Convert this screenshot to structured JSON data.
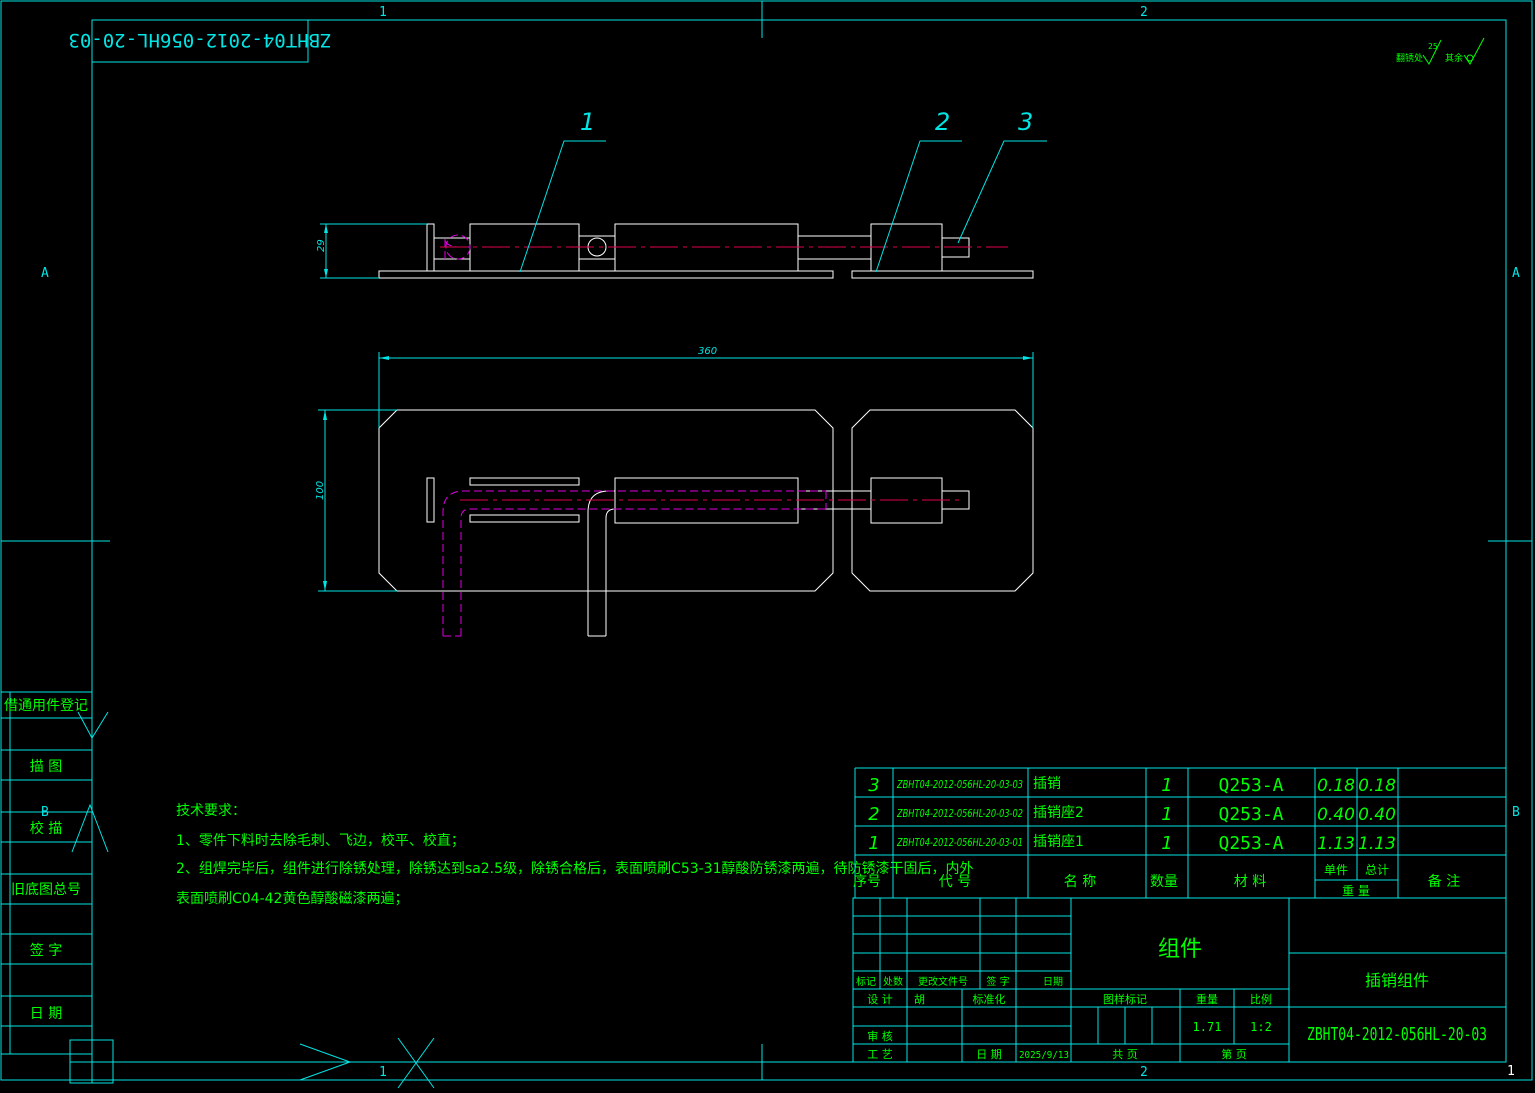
{
  "colors": {
    "frame": "#00e5e5",
    "title_text": "#00ff00",
    "geometry": "#ffffff",
    "leader": "#00e5e5",
    "centerline": "#e0004a",
    "hidden": "#e000e0",
    "dimension": "#00e5e5",
    "table_line": "#00e5e5"
  },
  "zones": {
    "col1": "1",
    "col2": "2",
    "rowA": "A",
    "rowB": "B",
    "corner": "1"
  },
  "mirrored_code": "ZBHT04-2012-056HL-20-03",
  "roughness": {
    "label1": "翻锈处",
    "value": "25",
    "label2": "其余"
  },
  "balloons": [
    "1",
    "2",
    "3"
  ],
  "dimensions": {
    "height_small": "29",
    "length": "360",
    "height_large": "100"
  },
  "left_strip": {
    "items": [
      "借通用件登记",
      "描 图",
      "校 描",
      "旧底图总号",
      "签 字",
      "日 期"
    ]
  },
  "notes": {
    "title": "技术要求：",
    "line1": "1、零件下料时去除毛刺、飞边，校平、校直；",
    "line2": "2、组焊完毕后，组件进行除锈处理，除锈达到sa2.5级，除锈合格后，表面喷刷C53-31醇酸防锈漆两遍，待防锈漆干固后，内外",
    "line3": "表面喷刷C04-42黄色醇酸磁漆两遍；"
  },
  "bom": {
    "rows": [
      {
        "no": "3",
        "code": "ZBHT04-2012-056HL-20-03-03",
        "name": "插销",
        "qty": "1",
        "material": "Q253-A",
        "unit_weight": "0.18",
        "total_weight": "0.18"
      },
      {
        "no": "2",
        "code": "ZBHT04-2012-056HL-20-03-02",
        "name": "插销座2",
        "qty": "1",
        "material": "Q253-A",
        "unit_weight": "0.40",
        "total_weight": "0.40"
      },
      {
        "no": "1",
        "code": "ZBHT04-2012-056HL-20-03-01",
        "name": "插销座1",
        "qty": "1",
        "material": "Q253-A",
        "unit_weight": "1.13",
        "total_weight": "1.13"
      }
    ],
    "headers": {
      "no": "序号",
      "code": "代 号",
      "name": "名 称",
      "qty": "数量",
      "material": "材 料",
      "unit": "单件",
      "total": "总计",
      "weight": "重 量",
      "remark": "备 注"
    }
  },
  "title_block": {
    "type_label": "组件",
    "part_name": "插销组件",
    "drawing_code": "ZBHT04-2012-056HL-20-03",
    "mark": "标记",
    "places": "处数",
    "change_doc": "更改文件号",
    "sign": "签 字",
    "date": "日期",
    "design": "设 计",
    "designer": "胡",
    "standardize": "标准化",
    "review": "审 核",
    "process": "工 艺",
    "date2": "日 期",
    "date_value": "2025/9/13",
    "stage_mark": "图样标记",
    "weight_label": "重量",
    "scale_label": "比例",
    "weight_value": "1.71",
    "scale_value": "1:2",
    "total_sheets": "共 页",
    "sheet_no": "第 页"
  }
}
